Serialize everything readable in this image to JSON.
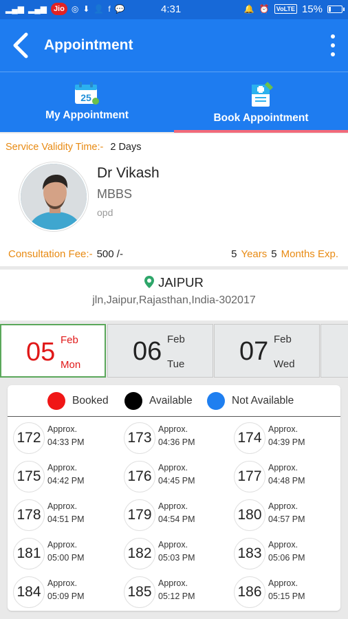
{
  "status_bar": {
    "time": "4:31",
    "carrier": "Jio",
    "volte": "VoLTE",
    "battery": "15%"
  },
  "app_bar": {
    "title": "Appointment"
  },
  "tabs": {
    "my": "My Appointment",
    "book": "Book Appointment",
    "calendar_day": "25"
  },
  "doctor": {
    "validity_label": "Service Validity Time:-",
    "validity_value": "2 Days",
    "name": "Dr Vikash",
    "degree": "MBBS",
    "department": "opd",
    "fee_label": "Consultation Fee:-",
    "fee_value": "500 /-",
    "exp_years": "5",
    "exp_years_label": "Years",
    "exp_months": "5",
    "exp_months_label": "Months",
    "exp_suffix": "Exp."
  },
  "location": {
    "city": "JAIPUR",
    "address": "jln,Jaipur,Rajasthan,India-302017"
  },
  "dates": [
    {
      "day": "05",
      "month": "Feb",
      "weekday": "Mon"
    },
    {
      "day": "06",
      "month": "Feb",
      "weekday": "Tue"
    },
    {
      "day": "07",
      "month": "Feb",
      "weekday": "Wed"
    }
  ],
  "legend": {
    "booked": "Booked",
    "available": "Available",
    "not_available": "Not Available",
    "colors": {
      "booked": "#f01616",
      "available": "#000000",
      "not_available": "#1f7ff0"
    }
  },
  "slots": [
    {
      "num": "172",
      "approx": "Approx.",
      "time": "04:33 PM"
    },
    {
      "num": "173",
      "approx": "Approx.",
      "time": "04:36 PM"
    },
    {
      "num": "174",
      "approx": "Approx.",
      "time": "04:39 PM"
    },
    {
      "num": "175",
      "approx": "Approx.",
      "time": "04:42 PM"
    },
    {
      "num": "176",
      "approx": "Approx.",
      "time": "04:45 PM"
    },
    {
      "num": "177",
      "approx": "Approx.",
      "time": "04:48 PM"
    },
    {
      "num": "178",
      "approx": "Approx.",
      "time": "04:51 PM"
    },
    {
      "num": "179",
      "approx": "Approx.",
      "time": "04:54 PM"
    },
    {
      "num": "180",
      "approx": "Approx.",
      "time": "04:57 PM"
    },
    {
      "num": "181",
      "approx": "Approx.",
      "time": "05:00 PM"
    },
    {
      "num": "182",
      "approx": "Approx.",
      "time": "05:03 PM"
    },
    {
      "num": "183",
      "approx": "Approx.",
      "time": "05:06 PM"
    },
    {
      "num": "184",
      "approx": "Approx.",
      "time": "05:09 PM"
    },
    {
      "num": "185",
      "approx": "Approx.",
      "time": "05:12 PM"
    },
    {
      "num": "186",
      "approx": "Approx.",
      "time": "05:15 PM"
    }
  ]
}
